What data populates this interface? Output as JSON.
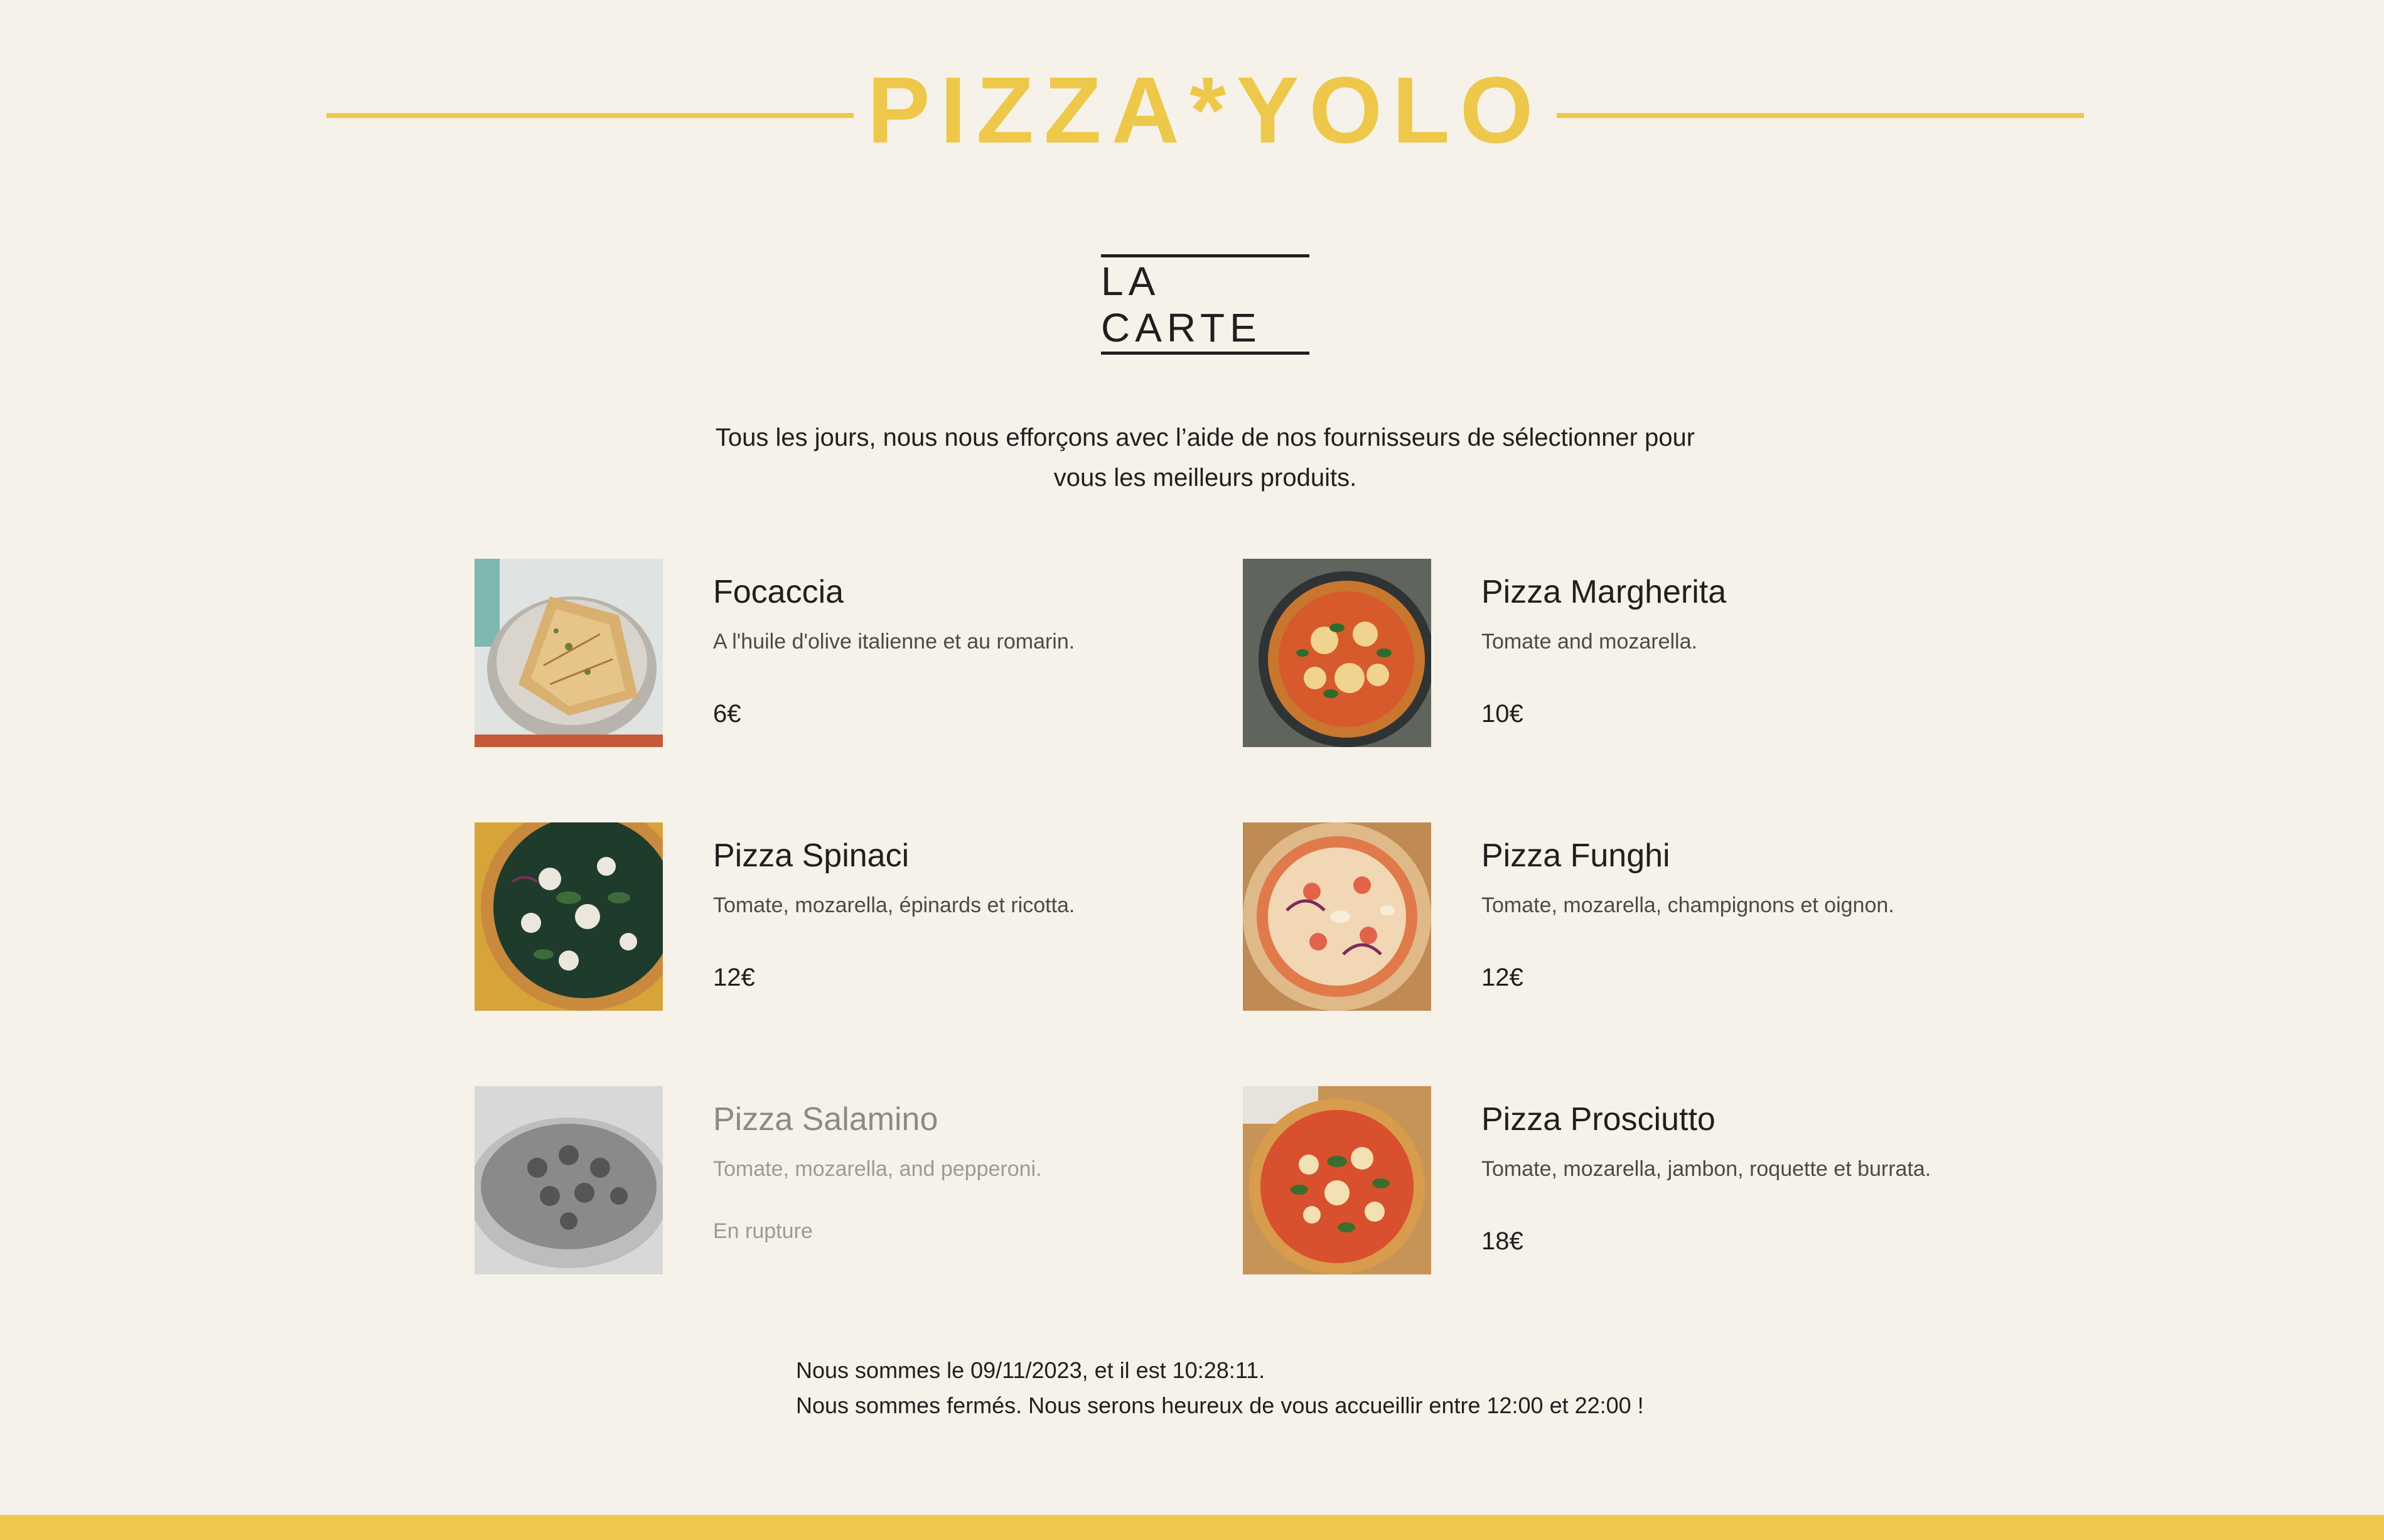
{
  "brand": {
    "name": "PIZZA*YOLO",
    "color": "#edc84a"
  },
  "section": {
    "title": "LA CARTE"
  },
  "intro": {
    "line1": "Tous les jours, nous nous efforçons avec l’aide de nos fournisseurs de sélectionner pour",
    "line2": "vous les meilleurs produits."
  },
  "menu": {
    "items": [
      {
        "name": "Focaccia",
        "desc": "A l'huile d'olive italienne et au romarin.",
        "price": "6€",
        "image": "focaccia-photo",
        "available": true
      },
      {
        "name": "Pizza Margherita",
        "desc": "Tomate and mozarella.",
        "price": "10€",
        "image": "pizza-margherita-photo",
        "available": true
      },
      {
        "name": "Pizza Spinaci",
        "desc": "Tomate, mozarella, épinards et ricotta.",
        "price": "12€",
        "image": "pizza-spinaci-photo",
        "available": true
      },
      {
        "name": "Pizza Funghi",
        "desc": "Tomate, mozarella, champignons et oignon.",
        "price": "12€",
        "image": "pizza-funghi-photo",
        "available": true
      },
      {
        "name": "Pizza Salamino",
        "desc": "Tomate, mozarella, and pepperoni.",
        "price": "En rupture",
        "image": "pizza-salamino-photo",
        "available": false
      },
      {
        "name": "Pizza Prosciutto",
        "desc": "Tomate, mozarella, jambon, roquette et burrata.",
        "price": "18€",
        "image": "pizza-prosciutto-photo",
        "available": true
      }
    ]
  },
  "notice": {
    "line1": "Nous sommes le 09/11/2023, et il est 10:28:11.",
    "line2": "Nous sommes fermés. Nous serons heureux de vous accueillir entre 12:00 et 22:00 !"
  }
}
